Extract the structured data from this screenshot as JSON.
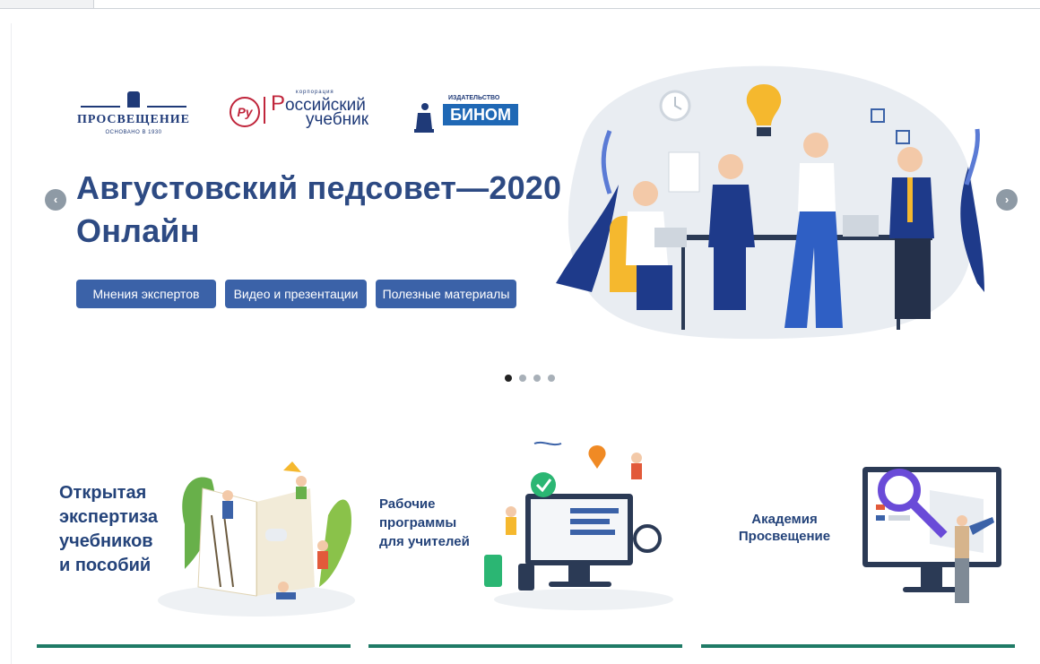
{
  "hero": {
    "title_line1": "Августовский педсовет—2020",
    "title_line2": "Онлайн",
    "buttons": [
      "Мнения экспертов",
      "Видео и презентации",
      "Полезные материалы"
    ],
    "prev_label": "‹",
    "next_label": "›",
    "slides_total": 4,
    "slide_active": 1
  },
  "logos": {
    "prosv_name": "ПРОСВЕЩЕНИЕ",
    "prosv_since": "ОСНОВАНО В 1930",
    "ru_small": "корпорация",
    "ru_mark": "Ру",
    "ru_line1_first": "Р",
    "ru_line1_rest": "оссийский",
    "ru_line2": "учебник",
    "binom_pub": "ИЗДАТЕЛЬСТВО",
    "binom_name": "БИНОМ"
  },
  "cards": [
    {
      "lines": [
        "Открытая",
        "экспертиза",
        "учебников",
        "и пособий"
      ]
    },
    {
      "lines": [
        "Рабочие",
        "программы",
        "для учителей"
      ]
    },
    {
      "lines": [
        "Академия",
        "Просвещение"
      ]
    }
  ],
  "colors": {
    "title": "#2d4a83",
    "button": "#3b62a8",
    "card_underline": "#1f7b66",
    "arrow": "#8e9aa5"
  }
}
